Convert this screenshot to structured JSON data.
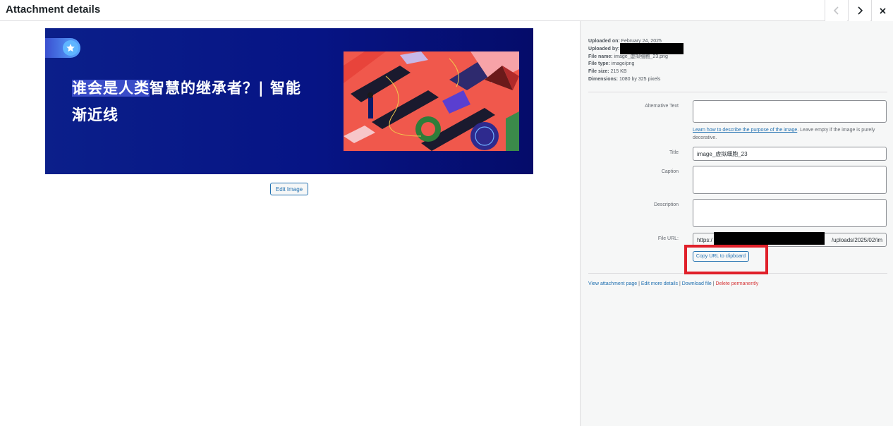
{
  "header": {
    "title": "Attachment details",
    "prev_icon": "chevron-left-icon",
    "next_icon": "chevron-right-icon",
    "close_icon": "close-icon"
  },
  "preview": {
    "headline_highlight": "谁会是人类",
    "headline_rest": "智慧的继承者？| 智能",
    "headline_line2": "渐近线",
    "badge_icon": "star-icon",
    "colors": {
      "background": "#061485",
      "art": "#f0584c"
    }
  },
  "edit_image_label": "Edit Image",
  "meta": {
    "uploaded_on_label": "Uploaded on:",
    "uploaded_on": "February 24, 2025",
    "uploaded_by_label": "Uploaded by:",
    "file_name_label": "File name:",
    "file_name": "image_虚拟细胞_23.png",
    "file_type_label": "File type:",
    "file_type": "image/png",
    "file_size_label": "File size:",
    "file_size": "215 KB",
    "dimensions_label": "Dimensions:",
    "dimensions": "1080 by 325 pixels"
  },
  "fields": {
    "alt_label": "Alternative Text",
    "alt_value": "",
    "help_link": "Learn how to describe the purpose of the image",
    "help_rest": ". Leave empty if the image is purely decorative.",
    "title_label": "Title",
    "title_value": "image_虚拟细胞_23",
    "caption_label": "Caption",
    "caption_value": "",
    "description_label": "Description",
    "description_value": "",
    "file_url_label": "File URL:",
    "file_url_start": "https:/",
    "file_url_end": "/uploads/2025/02/im",
    "copy_url_label": "Copy URL to clipboard"
  },
  "actions": {
    "view": "View attachment page",
    "edit_more": "Edit more details",
    "download": "Download file",
    "delete": "Delete permanently",
    "separator": "|"
  },
  "colors": {
    "link": "#2271b1",
    "danger": "#d63638",
    "highlight": "#e0202a"
  }
}
